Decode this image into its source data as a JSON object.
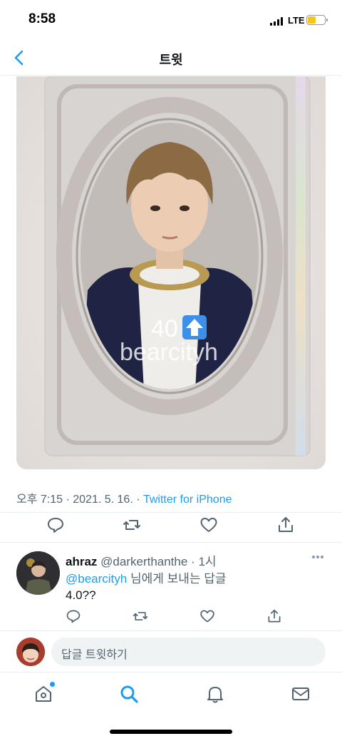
{
  "status_bar": {
    "time": "8:58",
    "network": "LTE"
  },
  "nav": {
    "title": "트윗"
  },
  "media": {
    "overlay_number": "40",
    "overlay_handle": "bearcityh"
  },
  "tweet": {
    "time": "오후 7:15",
    "date": "2021. 5. 16.",
    "separator": " · ",
    "source": "Twitter for iPhone"
  },
  "reply": {
    "display_name": "ahraz",
    "handle": "@darkerthanthe",
    "time": "1시",
    "reply_to_mention": "@bearcityh",
    "reply_to_suffix": " 님에게 보내는 답글",
    "text": "4.0??"
  },
  "compose": {
    "placeholder": "답글 트윗하기"
  },
  "icons": {
    "back": "chevron-left-icon",
    "reply": "reply-icon",
    "retweet": "retweet-icon",
    "like": "heart-icon",
    "share": "share-icon",
    "home": "home-icon",
    "search": "search-icon",
    "notifications": "bell-icon",
    "messages": "mail-icon"
  },
  "colors": {
    "accent": "#1d9bf0",
    "text_primary": "#0f1419",
    "text_secondary": "#536471",
    "divider": "#e6ecf0",
    "battery": "#f5c518"
  }
}
